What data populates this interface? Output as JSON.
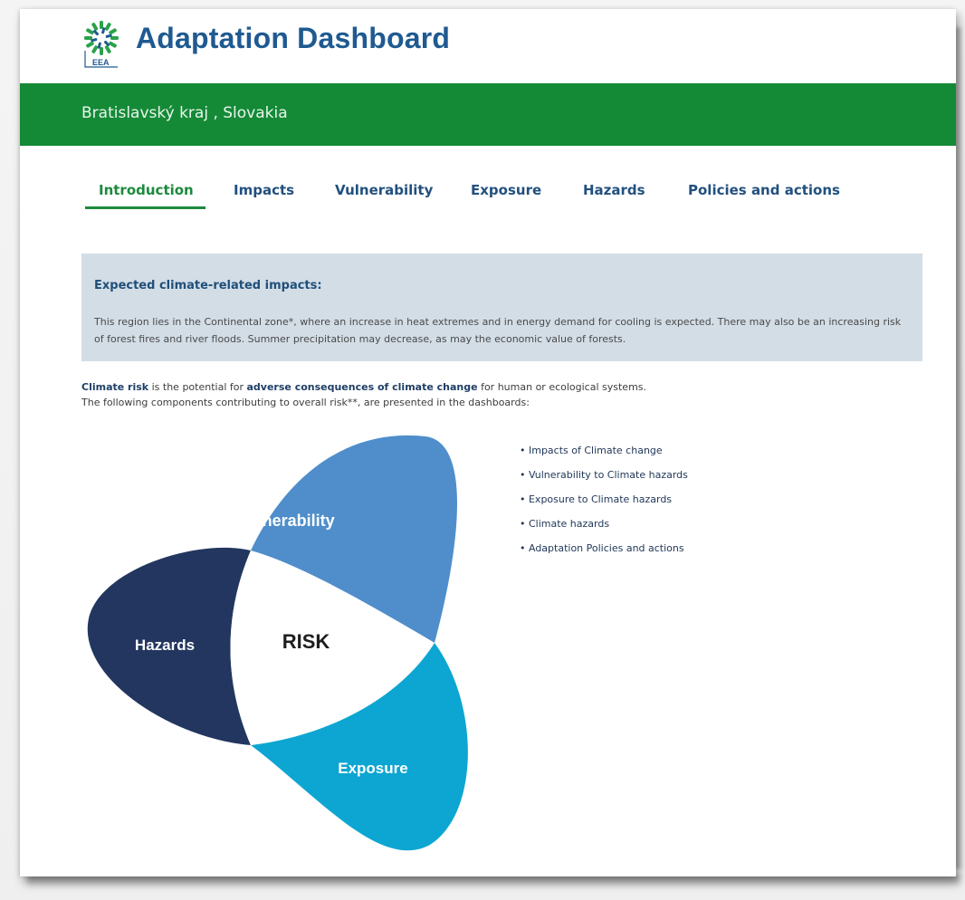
{
  "app": {
    "title": "Adaptation Dashboard",
    "logo_text": "EEA",
    "logo_icon": "eea-sun-logo-icon"
  },
  "region": {
    "name": "Bratislavský kraj , Slovakia"
  },
  "tabs": [
    {
      "label": "Introduction",
      "active": true
    },
    {
      "label": "Impacts",
      "active": false
    },
    {
      "label": "Vulnerability",
      "active": false
    },
    {
      "label": "Exposure",
      "active": false
    },
    {
      "label": "Hazards",
      "active": false
    },
    {
      "label": "Policies and actions",
      "active": false
    }
  ],
  "impacts_box": {
    "title": "Expected climate-related impacts:",
    "text": "This region lies in the Continental zone*, where an increase in heat extremes and in energy demand for cooling is expected. There may also be an increasing risk of forest fires and river floods. Summer precipitation may decrease, as may the economic value of forests."
  },
  "intro": {
    "line1_bold1": "Climate risk",
    "line1_part1": " is the potential for ",
    "line1_bold2": "adverse consequences of climate change",
    "line1_part2": " for human or ecological systems.",
    "line2": "The following components contributing to overall risk**, are presented in the dashboards:"
  },
  "diagram": {
    "center": "RISK",
    "petals": {
      "vulnerability": "Vulnerability",
      "hazards": "Hazards",
      "exposure": "Exposure"
    }
  },
  "components": [
    "• Impacts of Climate change",
    "• Vulnerability to Climate hazards",
    "• Exposure to Climate hazards",
    "• Climate hazards",
    "• Adaptation Policies and actions"
  ],
  "colors": {
    "brand_blue": "#1f5a91",
    "region_green": "#148a37",
    "tab_active": "#1c8a3d",
    "tab_inactive": "#22507e",
    "info_bg": "#d3dde6",
    "petal_vulnerability": "#4f8ecb",
    "petal_hazards": "#22365f",
    "petal_exposure": "#0da6d2"
  }
}
